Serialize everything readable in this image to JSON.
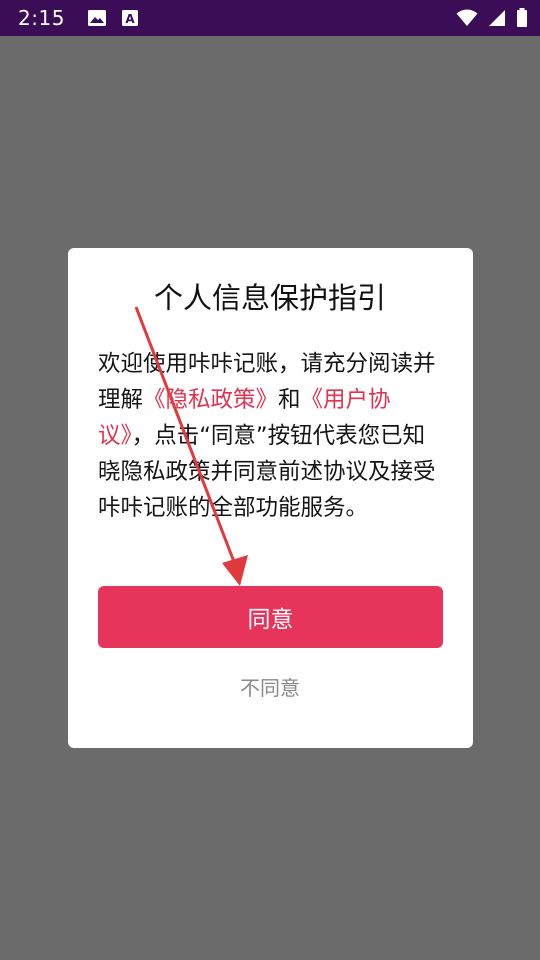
{
  "status_bar": {
    "time": "2:15",
    "left_icons": [
      "image-icon",
      "font-download-icon"
    ],
    "right_icons": [
      "wifi-icon",
      "signal-icon",
      "battery-icon"
    ]
  },
  "dialog": {
    "title": "个人信息保护指引",
    "body_parts": {
      "p1": "欢迎使用咔咔记账，请充分阅读并理解",
      "privacy_link": "《隐私政策》",
      "and": "和",
      "agreement_link": "《用户协议》",
      "p2": "，点击“同意”按钮代表您已知晓隐私政策并同意前述协议及接受咔咔记账的全部功能服务。"
    },
    "agree_label": "同意",
    "disagree_label": "不同意"
  },
  "colors": {
    "status_bar": "#3b0d57",
    "scrim": "#6b6b6b",
    "accent": "#e6345a",
    "link": "#e0334f",
    "annotation_arrow": "#e0393e"
  }
}
